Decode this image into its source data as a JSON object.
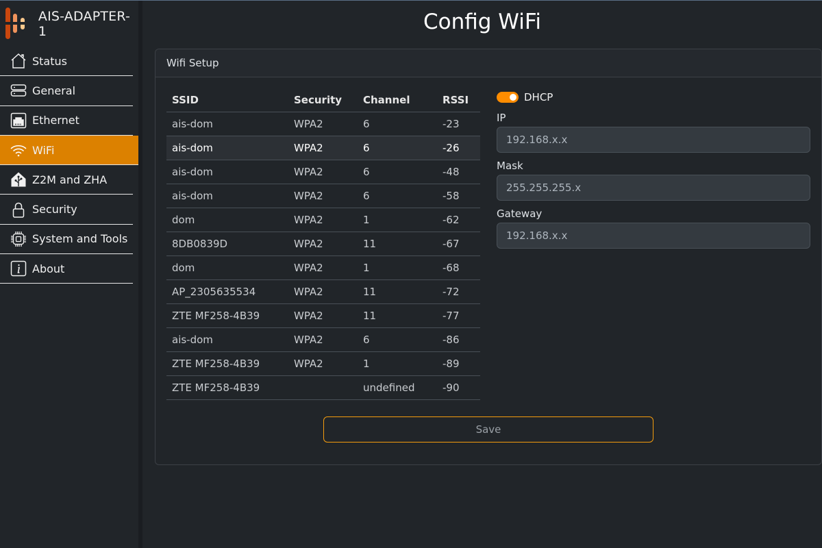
{
  "app": {
    "device_name": "AIS-ADAPTER-1"
  },
  "colors": {
    "accent": "#dc8100",
    "toggle": "#fd8c00",
    "save_border": "#f59d0e"
  },
  "sidebar": {
    "items": [
      {
        "label": "Status",
        "icon": "home-icon",
        "active": false
      },
      {
        "label": "General",
        "icon": "server-icon",
        "active": false
      },
      {
        "label": "Ethernet",
        "icon": "ethernet-icon",
        "active": false
      },
      {
        "label": "WiFi",
        "icon": "wifi-icon",
        "active": true
      },
      {
        "label": "Z2M and ZHA",
        "icon": "home-assistant-icon",
        "active": false
      },
      {
        "label": "Security",
        "icon": "lock-icon",
        "active": false
      },
      {
        "label": "System and Tools",
        "icon": "cpu-icon",
        "active": false
      },
      {
        "label": "About",
        "icon": "info-icon",
        "active": false
      }
    ]
  },
  "page": {
    "title": "Config WiFi"
  },
  "card": {
    "header": "Wifi Setup"
  },
  "table": {
    "columns": [
      "SSID",
      "Security",
      "Channel",
      "RSSI"
    ],
    "rows": [
      {
        "ssid": "ais-dom",
        "security": "WPA2",
        "channel": "6",
        "rssi": "-23"
      },
      {
        "ssid": "ais-dom",
        "security": "WPA2",
        "channel": "6",
        "rssi": "-26",
        "highlighted": true
      },
      {
        "ssid": "ais-dom",
        "security": "WPA2",
        "channel": "6",
        "rssi": "-48"
      },
      {
        "ssid": "ais-dom",
        "security": "WPA2",
        "channel": "6",
        "rssi": "-58"
      },
      {
        "ssid": "dom",
        "security": "WPA2",
        "channel": "1",
        "rssi": "-62"
      },
      {
        "ssid": "8DB0839D",
        "security": "WPA2",
        "channel": "11",
        "rssi": "-67"
      },
      {
        "ssid": "dom",
        "security": "WPA2",
        "channel": "1",
        "rssi": "-68"
      },
      {
        "ssid": "AP_2305635534",
        "security": "WPA2",
        "channel": "11",
        "rssi": "-72"
      },
      {
        "ssid": "ZTE MF258-4B39",
        "security": "WPA2",
        "channel": "11",
        "rssi": "-77"
      },
      {
        "ssid": "ais-dom",
        "security": "WPA2",
        "channel": "6",
        "rssi": "-86"
      },
      {
        "ssid": "ZTE MF258-4B39",
        "security": "WPA2",
        "channel": "1",
        "rssi": "-89"
      },
      {
        "ssid": "ZTE MF258-4B39",
        "security": "",
        "channel": "undefined",
        "rssi": "-90"
      }
    ]
  },
  "form": {
    "dhcp": {
      "label": "DHCP",
      "enabled": true
    },
    "ip": {
      "label": "IP",
      "placeholder": "192.168.x.x",
      "value": ""
    },
    "mask": {
      "label": "Mask",
      "placeholder": "255.255.255.x",
      "value": ""
    },
    "gateway": {
      "label": "Gateway",
      "placeholder": "192.168.x.x",
      "value": ""
    }
  },
  "actions": {
    "save_label": "Save"
  }
}
